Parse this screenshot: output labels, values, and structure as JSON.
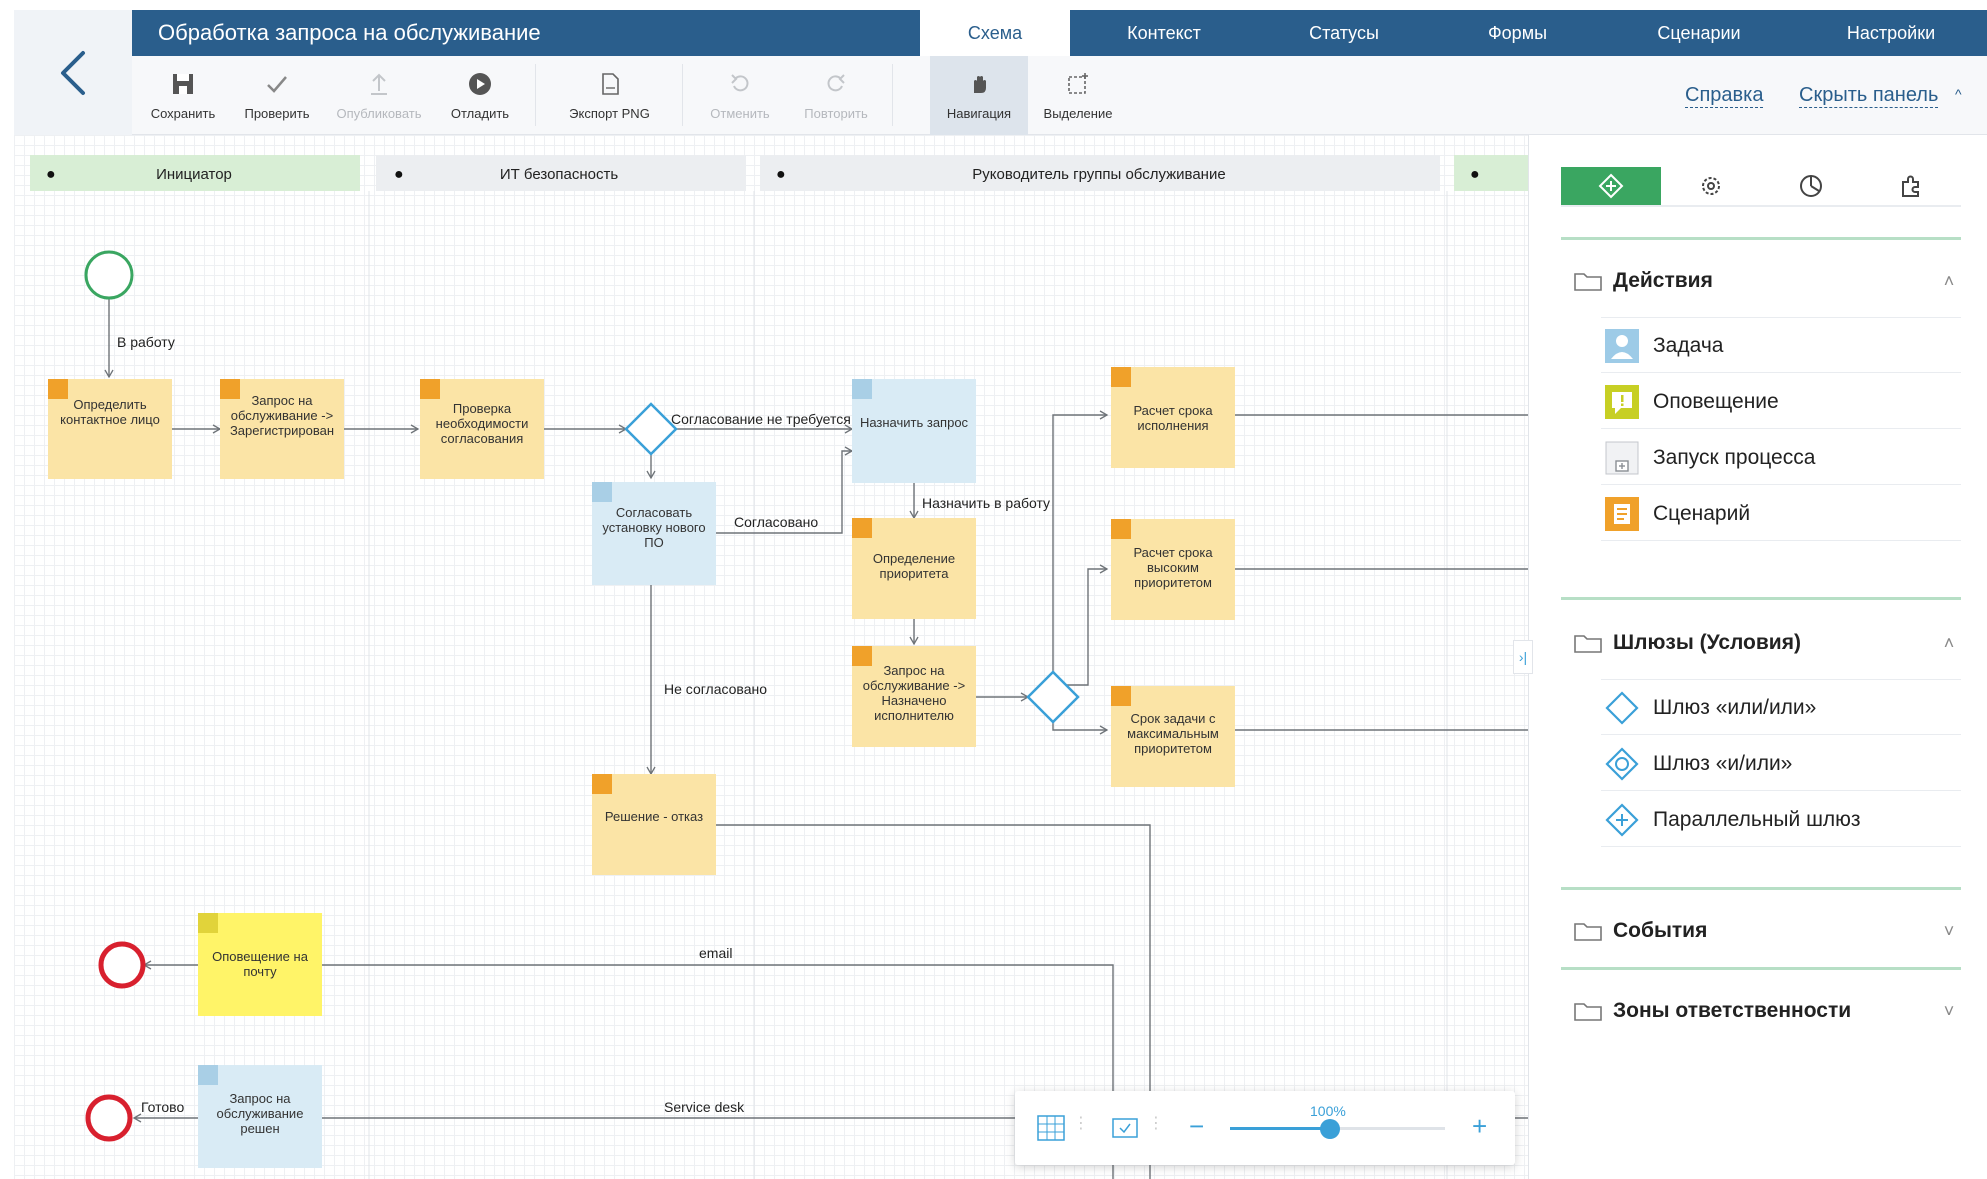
{
  "app_title": "Обработка запроса на обслуживание",
  "tabs": [
    {
      "label": "Схема",
      "active": true
    },
    {
      "label": "Контекст",
      "active": false
    },
    {
      "label": "Статусы",
      "active": false
    },
    {
      "label": "Формы",
      "active": false
    },
    {
      "label": "Сценарии",
      "active": false
    },
    {
      "label": "Настройки",
      "active": false
    }
  ],
  "toolbar": {
    "save": "Сохранить",
    "check": "Проверить",
    "publish": "Опубликовать",
    "debug": "Отладить",
    "export_png": "Экспорт PNG",
    "undo": "Отменить",
    "redo": "Повторить",
    "navigation": "Навигация",
    "selection": "Выделение",
    "help_link": "Справка",
    "hide_panel_link": "Скрыть панель"
  },
  "lanes": [
    {
      "name": "Инициатор",
      "color": "#d8eed5"
    },
    {
      "name": "ИТ безопасность",
      "color": "#eceef1"
    },
    {
      "name": "Руководитель группы обслуживание",
      "color": "#eceef1"
    },
    {
      "name": "",
      "color": "#d8eed5"
    }
  ],
  "nodes": {
    "n1": "Определить контактное лицо",
    "n2": "Запрос на обслуживание -> Зарегистрирован",
    "n3": "Проверка необходимости согласования",
    "n4": "Согласовать установку нового ПО",
    "n5": "Назначить запрос",
    "n6": "Определение приоритета",
    "n7": "Запрос на обслуживание -> Назначено исполнителю",
    "n8": "Расчет срока исполнения",
    "n9": "Расчет срока высоким приоритетом",
    "n10": "Срок задачи с максимальным приоритетом",
    "n11": "Решение - отказ",
    "n12": "Оповещение на почту",
    "n13": "Запрос на обслуживание решен"
  },
  "edge_labels": {
    "to_work": "В работу",
    "no_approval": "Согласование не требуется",
    "approved": "Согласовано",
    "assign_work": "Назначить в работу",
    "not_approved": "Не согласовано",
    "email": "email",
    "service_desk": "Service desk",
    "done": "Готово"
  },
  "panel": {
    "sections": [
      {
        "title": "Действия",
        "expanded": true,
        "items": [
          {
            "label": "Задача",
            "icon": "user-task-icon"
          },
          {
            "label": "Оповещение",
            "icon": "notification-icon"
          },
          {
            "label": "Запуск процесса",
            "icon": "subprocess-icon"
          },
          {
            "label": "Сценарий",
            "icon": "script-icon"
          }
        ]
      },
      {
        "title": "Шлюзы (Условия)",
        "expanded": true,
        "items": [
          {
            "label": "Шлюз «или/или»",
            "icon": "xor-gateway-icon"
          },
          {
            "label": "Шлюз «и/или»",
            "icon": "or-gateway-icon"
          },
          {
            "label": "Параллельный шлюз",
            "icon": "parallel-gateway-icon"
          }
        ]
      },
      {
        "title": "События",
        "expanded": false,
        "items": []
      },
      {
        "title": "Зоны ответственности",
        "expanded": false,
        "items": []
      }
    ]
  },
  "zoom": {
    "level_label": "100%",
    "level": 1.0
  },
  "colors": {
    "brand": "#2a5e8c",
    "accent_green": "#3aa661",
    "script_node": "#fbe4a6",
    "user_node": "#d9ebf5",
    "notify_node": "#fff468",
    "end_event": "#d8202e",
    "start_event": "#3aa661",
    "gateway": "#3aa0d8"
  }
}
